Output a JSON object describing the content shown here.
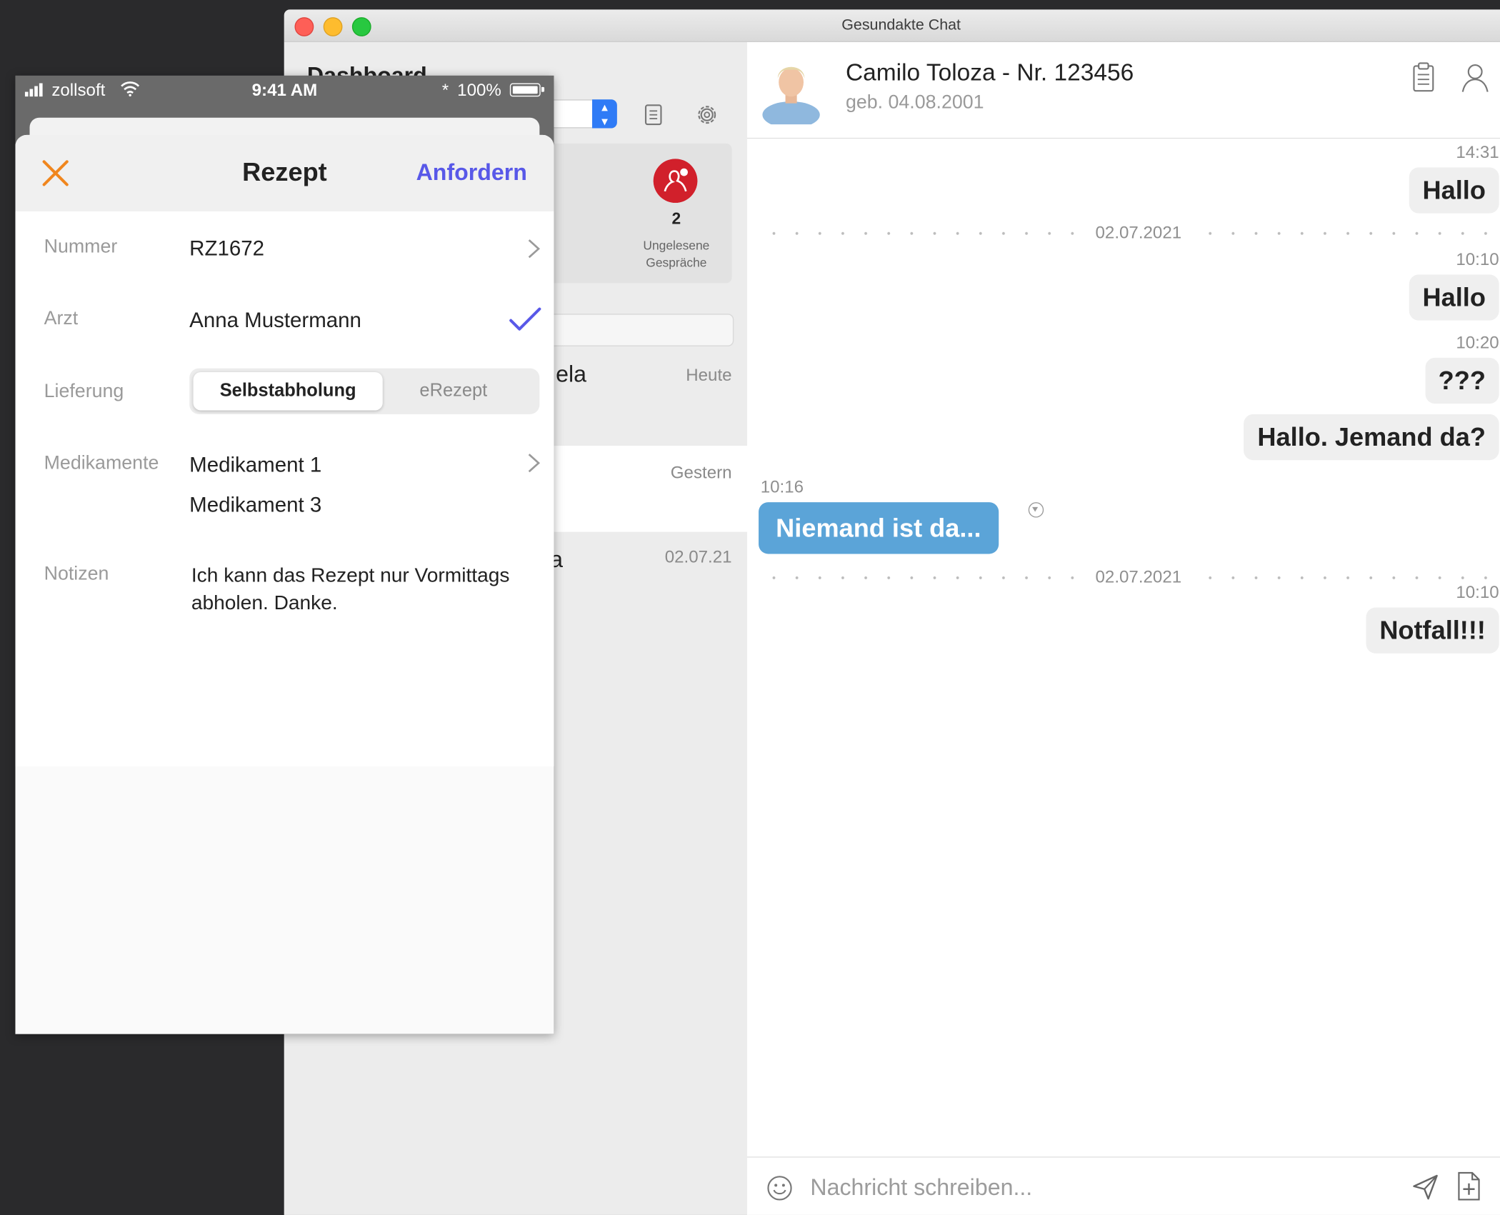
{
  "mac_window": {
    "title": "Gesundakte Chat"
  },
  "dashboard": {
    "title": "Dashboard",
    "stat": {
      "count": "2",
      "label": "Ungelesene Gespräche",
      "badge_color": "#d1202b"
    },
    "conversations": [
      {
        "name_fragment": "ela",
        "time": "Heute"
      },
      {
        "name_fragment": "",
        "time": "Gestern"
      },
      {
        "name_fragment": "a",
        "time": "02.07.21"
      }
    ]
  },
  "chat": {
    "patient_name": "Camilo Toloza - Nr. 123456",
    "patient_dob": "geb. 04.08.2001",
    "header_icons": [
      "clipboard-icon",
      "person-icon"
    ],
    "messages": [
      {
        "type": "timestamp",
        "text": "14:31"
      },
      {
        "type": "outgoing",
        "text": "Hallo"
      },
      {
        "type": "divider",
        "text": "02.07.2021"
      },
      {
        "type": "timestamp",
        "text": "10:10"
      },
      {
        "type": "outgoing",
        "text": "Hallo"
      },
      {
        "type": "timestamp",
        "text": "10:20"
      },
      {
        "type": "outgoing",
        "text": "???"
      },
      {
        "type": "outgoing",
        "text": "Hallo. Jemand da?"
      },
      {
        "type": "timestamp_left",
        "text": "10:16"
      },
      {
        "type": "incoming",
        "text": "Niemand ist da..."
      },
      {
        "type": "divider",
        "text": "02.07.2021"
      },
      {
        "type": "timestamp",
        "text": "10:10"
      },
      {
        "type": "outgoing",
        "text": "Notfall!!!"
      }
    ],
    "incoming_color": "#5ba4d8",
    "composer": {
      "placeholder": "Nachricht schreiben..."
    }
  },
  "ios": {
    "status": {
      "carrier": "zollsoft",
      "time": "9:41 AM",
      "battery": "100%"
    },
    "sheet": {
      "title": "Rezept",
      "action": "Anfordern",
      "action_color": "#5858e8",
      "close_color": "#f0861e"
    },
    "form": {
      "nummer": {
        "label": "Nummer",
        "value": "RZ1672"
      },
      "arzt": {
        "label": "Arzt",
        "value": "Anna Mustermann"
      },
      "lieferung": {
        "label": "Lieferung",
        "options": [
          "Selbstabholung",
          "eRezept"
        ],
        "selected": "Selbstabholung"
      },
      "medikamente": {
        "label": "Medikamente",
        "items": [
          "Medikament 1",
          "Medikament 3"
        ]
      },
      "notizen": {
        "label": "Notizen",
        "value": "Ich kann das Rezept nur Vormittags abholen. Danke."
      }
    }
  }
}
